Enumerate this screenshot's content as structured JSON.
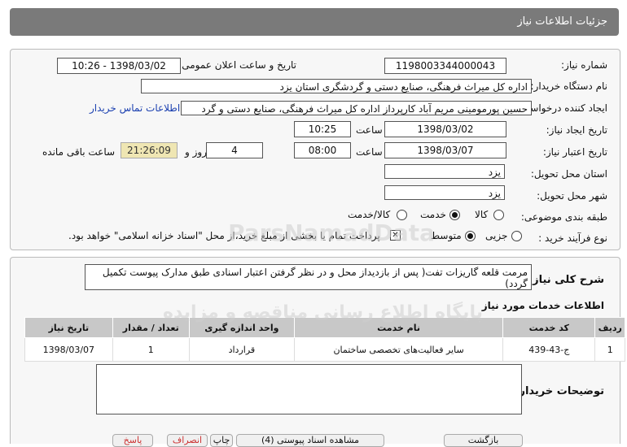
{
  "header": {
    "title": "جزئیات اطلاعات نیاز"
  },
  "fields": {
    "need_number_label": "شماره نیاز:",
    "need_number": "1198003344000043",
    "announce_label": "تاریخ و ساعت اعلان عمومی:",
    "announce_value": "1398/03/02 - 10:26",
    "buyer_org_label": "نام دستگاه خریدار:",
    "buyer_org": "اداره کل میراث فرهنگی، صنایع دستی و گردشگری استان یزد",
    "requester_label": "ایجاد کننده درخواست:",
    "requester": "حسین پورمومینی مریم آباد کارپرداز اداره کل میراث فرهنگی، صنایع دستی و گرد",
    "contact_link": "اطلاعات تماس خریدار",
    "created_label": "تاریخ ایجاد نیاز:",
    "created_date": "1398/03/02",
    "time_label": "ساعت",
    "created_time": "10:25",
    "validity_label": "تاریخ اعتبار نیاز:",
    "validity_date": "1398/03/07",
    "validity_time": "08:00",
    "days": "4",
    "days_label": "روز و",
    "remaining": "21:26:09",
    "remaining_label": "ساعت باقی مانده",
    "province_label": "استان محل تحویل:",
    "province": "یزد",
    "city_label": "شهر محل تحویل:",
    "city": "یزد",
    "category_label": "طبقه بندی موضوعی:",
    "category_options": [
      "کالا",
      "خدمت",
      "کالا/خدمت"
    ],
    "category_selected": "خدمت",
    "process_label": "نوع فرآیند خرید :",
    "process_options": [
      "جزیی",
      "متوسط"
    ],
    "process_selected": "متوسط",
    "payment_note": "پرداخت تمام یا بخشی از مبلغ خرید،از محل \"اسناد خزانه اسلامی\" خواهد بود."
  },
  "description": {
    "label": "شرح کلی نیاز:",
    "text": "مرمت قلعه گاریزات تفت( پس از بازدیداز محل و در نظر گرفتن اعتبار اسنادی طبق مدارک پیوست تکمیل گردد)"
  },
  "services": {
    "title": "اطلاعات خدمات مورد نیاز",
    "columns": [
      "ردیف",
      "کد خدمت",
      "نام خدمت",
      "واحد اندازه گیری",
      "تعداد / مقدار",
      "تاریخ نیاز"
    ],
    "rows": [
      [
        "1",
        "ج-43-439",
        "سایر فعالیت‌های تخصصی ساختمان",
        "قرارداد",
        "1",
        "1398/03/07"
      ]
    ]
  },
  "buyer_notes": {
    "label": "توضیحات خریدار:",
    "text": ""
  },
  "watermark": {
    "line1": "ParsNamadData",
    "line2": "پایگاه اطلاع رسانی مناقصه و مزایده"
  },
  "footer_buttons": [
    "بازگشت",
    "مشاهده اسناد پیوستی (4)",
    "چاپ",
    "انصراف",
    "پاسخ"
  ]
}
